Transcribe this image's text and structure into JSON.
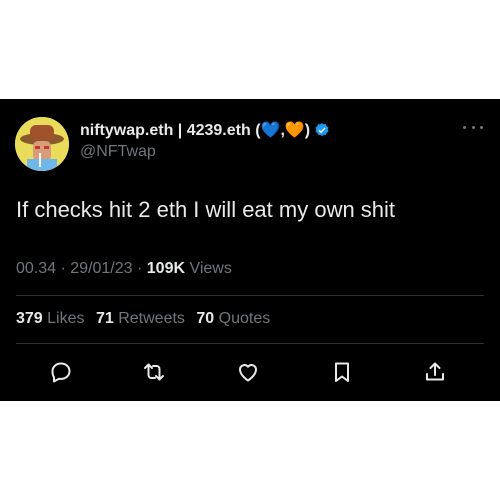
{
  "tweet": {
    "display_name": "niftywap.eth | 4239.eth (💙,🧡)",
    "handle": "@NFTwap",
    "text": "If checks hit 2 eth I will eat my own shit",
    "time": "00.34",
    "separator": " · ",
    "date": "29/01/23",
    "views_count": "109K",
    "views_label": "Views",
    "likes_count": "379",
    "likes_label": "Likes",
    "retweets_count": "71",
    "retweets_label": "Retweets",
    "quotes_count": "70",
    "quotes_label": "Quotes"
  },
  "colors": {
    "background": "#000000",
    "text": "#e7e9ea",
    "muted": "#71767b",
    "verified": "#1d9bf0",
    "divider": "#2f3336"
  },
  "icons": [
    "verified-badge-icon",
    "more-icon",
    "reply-icon",
    "retweet-icon",
    "like-icon",
    "bookmark-icon",
    "share-icon"
  ]
}
